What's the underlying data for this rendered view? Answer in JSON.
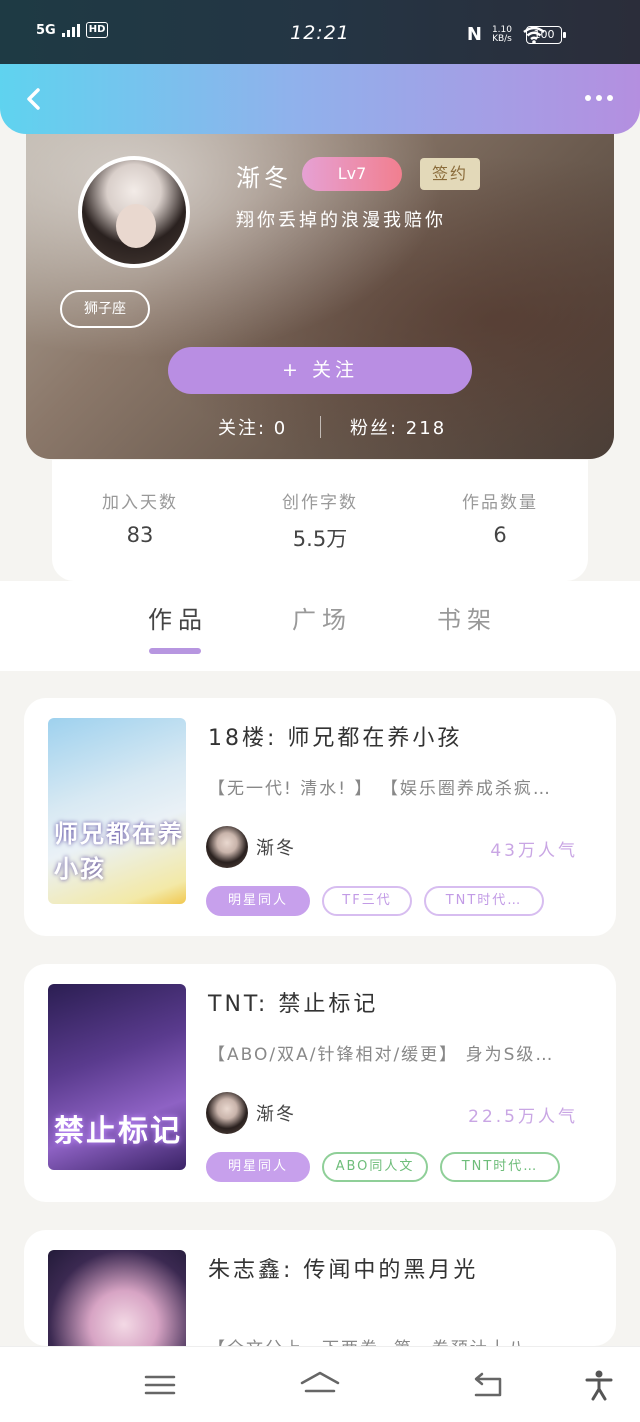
{
  "status_bar": {
    "network": "5G",
    "hd": "HD",
    "time": "12:21",
    "nfc": "N",
    "speed_value": "1.10",
    "speed_unit": "KB/s",
    "battery": "100"
  },
  "nav": {
    "back_icon": "chevron-left-icon",
    "more_icon": "more-dots-icon"
  },
  "profile": {
    "username": "渐冬",
    "level": "Lv7",
    "sign_badge": "签约",
    "bio": "翔你丢掉的浪漫我赔你",
    "zodiac": "狮子座",
    "follow_button": "+  关注",
    "following": "关注: 0",
    "fans": "粉丝: 218"
  },
  "stats": [
    {
      "label": "加入天数",
      "value": "83"
    },
    {
      "label": "创作字数",
      "value": "5.5万"
    },
    {
      "label": "作品数量",
      "value": "6"
    }
  ],
  "tabs": [
    {
      "label": "作品",
      "active": true
    },
    {
      "label": "广场",
      "active": false
    },
    {
      "label": "书架",
      "active": false
    }
  ],
  "books": [
    {
      "title": "18楼: 师兄都在养小孩",
      "description": "【无一代! 清水! 】 【娱乐圈养成杀疯…",
      "cover_text": "师兄都在养小孩",
      "author": "渐冬",
      "popularity": "43万人气",
      "tags": [
        {
          "label": "明星同人",
          "style": "solid"
        },
        {
          "label": "TF三代",
          "style": "outline-purple"
        },
        {
          "label": "TNT时代…",
          "style": "outline-purple"
        }
      ]
    },
    {
      "title": "TNT: 禁止标记",
      "description": "【ABO/双A/针锋相对/缓更】 身为S级…",
      "cover_text": "禁止标记",
      "author": "渐冬",
      "popularity": "22.5万人气",
      "tags": [
        {
          "label": "明星同人",
          "style": "solid"
        },
        {
          "label": "ABO同人文",
          "style": "outline-green"
        },
        {
          "label": "TNT时代…",
          "style": "outline-green"
        }
      ]
    },
    {
      "title": "朱志鑫: 传闻中的黑月光",
      "description": "【全文分上、下两卷, 第一卷预计十八…"
    }
  ],
  "bottom_nav": {
    "menu_icon": "menu-icon",
    "home_icon": "home-icon",
    "back_icon": "back-arrow-icon",
    "accessibility_icon": "accessibility-icon"
  }
}
